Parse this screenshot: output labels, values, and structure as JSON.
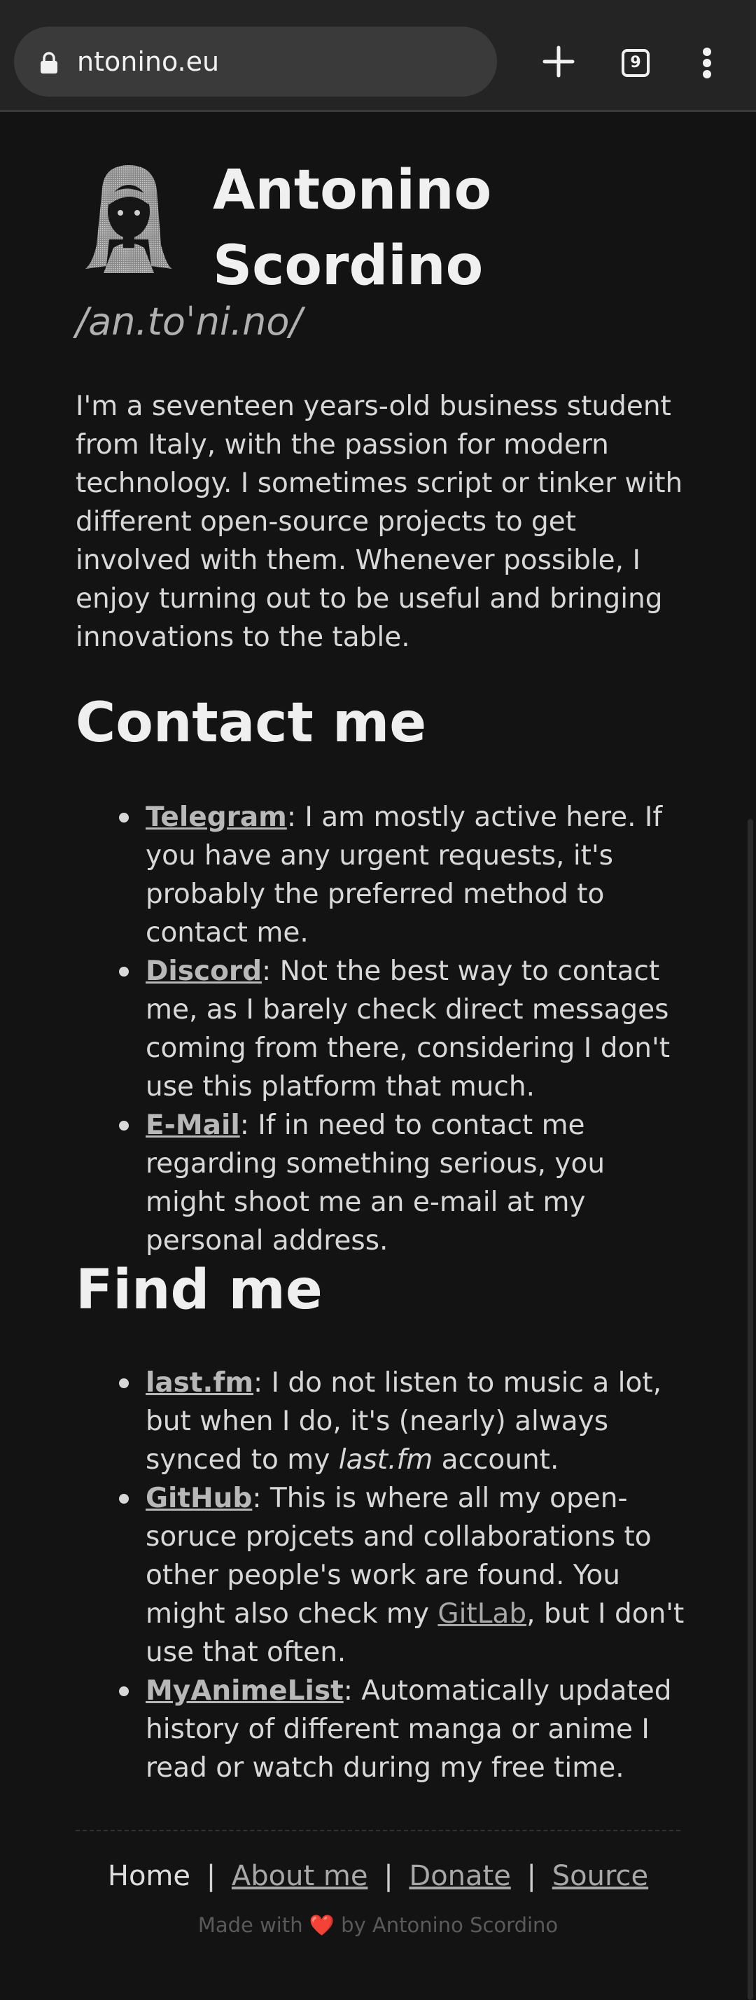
{
  "browser": {
    "url": "ntonino.eu",
    "tab_count": "9"
  },
  "header": {
    "name_line1": "Antonino",
    "name_line2": "Scordino",
    "phonetic": "/an.toˈni.no/"
  },
  "bio": "I'm a seventeen years-old business student from Italy, with the passion for modern technology. I sometimes script or tinker with different open-source projects to get involved with them. Whenever possible, I enjoy turning out to be useful and bringing innovations to the table.",
  "contact": {
    "heading": "Contact me",
    "items": [
      {
        "label": "Telegram",
        "text": ": I am mostly active here. If you have any urgent requests, it's probably the preferred method to contact me."
      },
      {
        "label": "Discord",
        "text": ": Not the best way to contact me, as I barely check direct messages coming from there, considering I don't use this platform that much."
      },
      {
        "label": "E-Mail",
        "text": ": If in need to contact me regarding something serious, you might shoot me an e-mail at my personal address."
      }
    ]
  },
  "find": {
    "heading": "Find me",
    "lastfm": {
      "label": "last.fm",
      "text_a": ": I do not listen to music a lot, but when I do, it's (nearly) always synced to my ",
      "italic": "last.fm",
      "text_b": " account."
    },
    "github": {
      "label": "GitHub",
      "text_a": ": This is where all my open-soruce projcets and collaborations to other people's work are found. You might also check my ",
      "gitlab": "GitLab",
      "text_b": ", but I don't use that often."
    },
    "mal": {
      "label": "MyAnimeList",
      "text": ": Automatically updated history of different manga or anime I read or watch during my free time."
    }
  },
  "footer": {
    "home": "Home",
    "sep": "|",
    "about": "About me",
    "donate": "Donate",
    "source": "Source",
    "credit_a": "Made with",
    "heart": "❤️",
    "credit_b": "by Antonino Scordino"
  },
  "colors": {
    "background": "#131313",
    "chrome": "#242424",
    "heart": "#e0443c"
  }
}
